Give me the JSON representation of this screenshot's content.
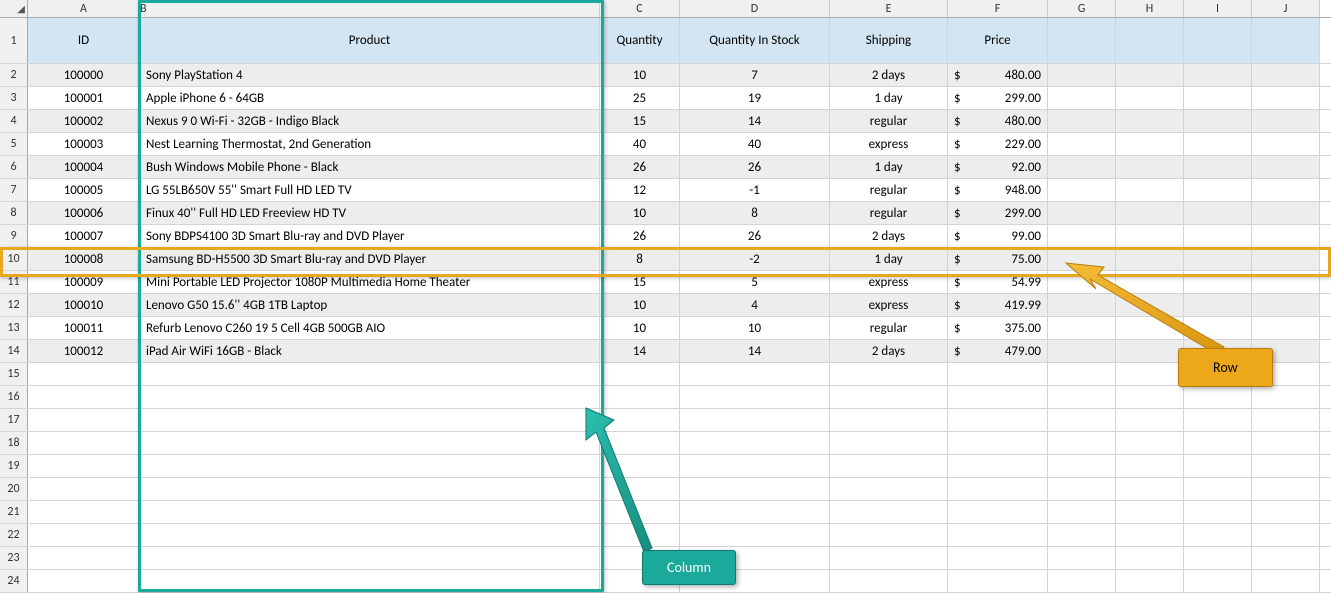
{
  "col_headers": [
    "A",
    "B",
    "C",
    "D",
    "E",
    "F",
    "G",
    "H",
    "I",
    "J"
  ],
  "row_headers": [
    "1",
    "2",
    "3",
    "4",
    "5",
    "6",
    "7",
    "8",
    "9",
    "10",
    "11",
    "12",
    "13",
    "14",
    "15",
    "16",
    "17",
    "18",
    "19",
    "20",
    "21",
    "22",
    "23",
    "24"
  ],
  "corner_glyph": "◢",
  "headers": {
    "id": "ID",
    "product": "Product",
    "quantity": "Quantity",
    "stock": "Quantity In Stock",
    "shipping": "Shipping",
    "price": "Price"
  },
  "rows": [
    {
      "id": "100000",
      "product": "Sony PlayStation 4",
      "qty": "10",
      "stock": "7",
      "ship": "2 days",
      "price": "480.00"
    },
    {
      "id": "100001",
      "product": "Apple iPhone 6 - 64GB",
      "qty": "25",
      "stock": "19",
      "ship": "1 day",
      "price": "299.00"
    },
    {
      "id": "100002",
      "product": "Nexus 9 0 Wi-Fi - 32GB - Indigo Black",
      "qty": "15",
      "stock": "14",
      "ship": "regular",
      "price": "480.00"
    },
    {
      "id": "100003",
      "product": "Nest Learning Thermostat, 2nd Generation",
      "qty": "40",
      "stock": "40",
      "ship": "express",
      "price": "229.00"
    },
    {
      "id": "100004",
      "product": "Bush Windows Mobile Phone - Black",
      "qty": "26",
      "stock": "26",
      "ship": "1 day",
      "price": "92.00"
    },
    {
      "id": "100005",
      "product": "LG 55LB650V 55'' Smart Full HD LED TV",
      "qty": "12",
      "stock": "-1",
      "ship": "regular",
      "price": "948.00"
    },
    {
      "id": "100006",
      "product": "Finux 40'' Full HD LED Freeview HD TV",
      "qty": "10",
      "stock": "8",
      "ship": "regular",
      "price": "299.00"
    },
    {
      "id": "100007",
      "product": "Sony BDPS4100 3D Smart Blu-ray and DVD Player",
      "qty": "26",
      "stock": "26",
      "ship": "2 days",
      "price": "99.00"
    },
    {
      "id": "100008",
      "product": "Samsung BD-H5500 3D Smart Blu-ray and DVD Player",
      "qty": "8",
      "stock": "-2",
      "ship": "1 day",
      "price": "75.00"
    },
    {
      "id": "100009",
      "product": "Mini Portable LED Projector 1080P Multimedia Home Theater",
      "qty": "15",
      "stock": "5",
      "ship": "express",
      "price": "54.99"
    },
    {
      "id": "100010",
      "product": "Lenovo G50 15.6'' 4GB 1TB Laptop",
      "qty": "10",
      "stock": "4",
      "ship": "express",
      "price": "419.99"
    },
    {
      "id": "100011",
      "product": "Refurb Lenovo C260 19 5 Cell 4GB 500GB AIO",
      "qty": "10",
      "stock": "10",
      "ship": "regular",
      "price": "375.00"
    },
    {
      "id": "100012",
      "product": "iPad Air WiFi 16GB - Black",
      "qty": "14",
      "stock": "14",
      "ship": "2 days",
      "price": "479.00"
    }
  ],
  "currency_symbol": "$",
  "callouts": {
    "column": "Column",
    "row": "Row"
  }
}
